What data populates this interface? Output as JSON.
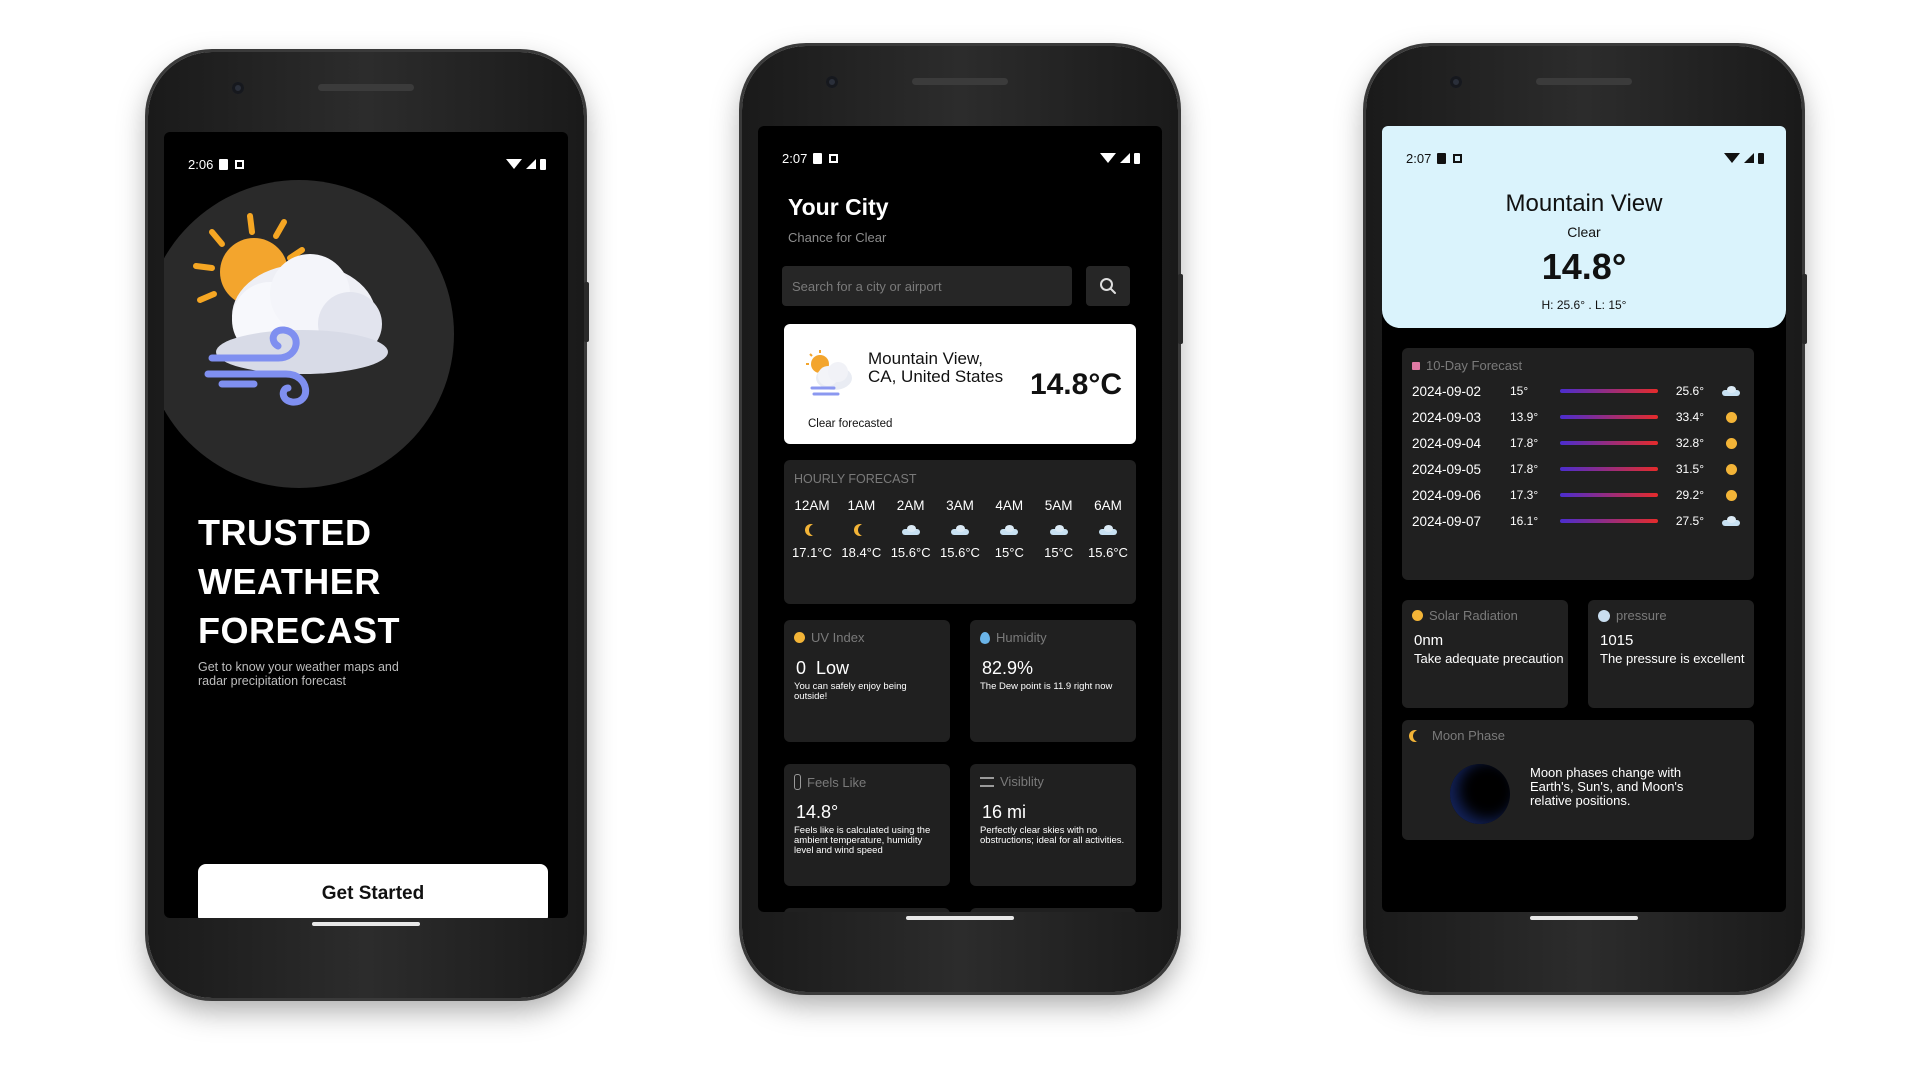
{
  "phone1": {
    "status_time": "2:06",
    "headline": [
      "TRUSTED",
      "WEATHER",
      "FORECAST"
    ],
    "subtitle": "Get to know your weather maps and radar precipitation forecast",
    "cta_label": "Get Started",
    "hero_icon": "sun-cloud-wind-icon"
  },
  "phone2": {
    "status_time": "2:07",
    "city_title": "Your City",
    "city_subtitle": "Chance for Clear",
    "search_placeholder": "Search for a city or airport",
    "location_card": {
      "location": "Mountain View, CA, United States",
      "temperature": "14.8°C",
      "forecast": "Clear forecasted"
    },
    "hourly": {
      "label": "HOURLY FORECAST",
      "hours": [
        {
          "time": "12AM",
          "icon": "moon-icon",
          "temp": "17.1°C"
        },
        {
          "time": "1AM",
          "icon": "moon-icon",
          "temp": "18.4°C"
        },
        {
          "time": "2AM",
          "icon": "cloud-icon",
          "temp": "15.6°C"
        },
        {
          "time": "3AM",
          "icon": "cloud-icon",
          "temp": "15.6°C"
        },
        {
          "time": "4AM",
          "icon": "cloud-icon",
          "temp": "15°C"
        },
        {
          "time": "5AM",
          "icon": "cloud-icon",
          "temp": "15°C"
        },
        {
          "time": "6AM",
          "icon": "cloud-icon",
          "temp": "15.6°C"
        }
      ]
    },
    "tiles": {
      "uv": {
        "label": "UV Index",
        "value": "0  Low",
        "note": "You can safely enjoy being outside!"
      },
      "humidity": {
        "label": "Humidity",
        "value": "82.9%",
        "note": "The Dew point is 11.9 right now"
      },
      "feels": {
        "label": "Feels Like",
        "value": "14.8°",
        "note": "Feels like is calculated using the ambient temperature, humidity level and wind speed"
      },
      "visibility": {
        "label": "Visiblity",
        "value": "16 mi",
        "note": "Perfectly clear skies with no obstructions; ideal for all activities."
      }
    }
  },
  "phone3": {
    "status_time": "2:07",
    "header": {
      "name": "Mountain View",
      "condition": "Clear",
      "temperature": "14.8°",
      "high_low": "H: 25.6° .  L: 15°"
    },
    "tenday": {
      "label": "10-Day Forecast",
      "rows": [
        {
          "date": "2024-09-02",
          "low": "15°",
          "high": "25.6°",
          "icon": "cloud-icon"
        },
        {
          "date": "2024-09-03",
          "low": "13.9°",
          "high": "33.4°",
          "icon": "sun-icon"
        },
        {
          "date": "2024-09-04",
          "low": "17.8°",
          "high": "32.8°",
          "icon": "sun-icon"
        },
        {
          "date": "2024-09-05",
          "low": "17.8°",
          "high": "31.5°",
          "icon": "sun-icon"
        },
        {
          "date": "2024-09-06",
          "low": "17.3°",
          "high": "29.2°",
          "icon": "sun-icon"
        },
        {
          "date": "2024-09-07",
          "low": "16.1°",
          "high": "27.5°",
          "icon": "cloud-icon"
        }
      ]
    },
    "solar": {
      "label": "Solar Radiation",
      "value": "0nm",
      "note": "Take adequate precaution"
    },
    "pressure": {
      "label": "pressure",
      "value": "1015",
      "note": "The pressure is excellent"
    },
    "moon": {
      "label": "Moon Phase",
      "text": "Moon phases change with Earth's, Sun's, and Moon's relative positions."
    }
  }
}
